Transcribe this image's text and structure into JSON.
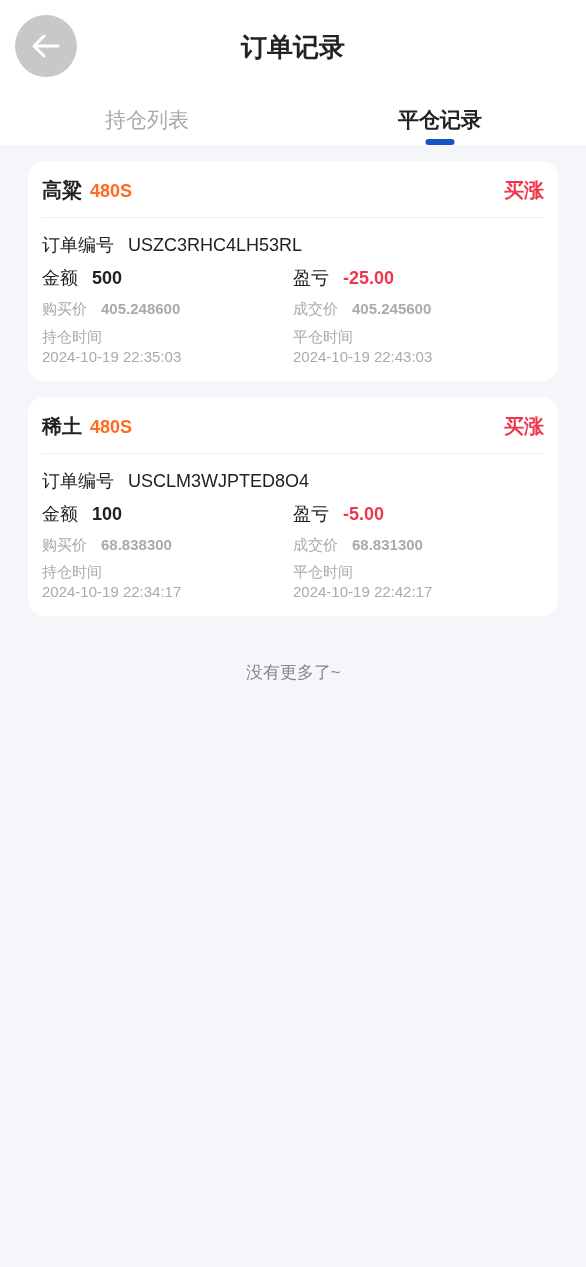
{
  "header": {
    "title": "订单记录"
  },
  "tabs": [
    {
      "label": "持仓列表",
      "selected": false
    },
    {
      "label": "平仓记录",
      "selected": true
    }
  ],
  "orders": [
    {
      "name": "高粱",
      "period": "480S",
      "direction": "买涨",
      "order_no_label": "订单编号",
      "order_no": "USZC3RHC4LH53RL",
      "amount_label": "金额",
      "amount": "500",
      "pnl_label": "盈亏",
      "pnl": "-25.00",
      "buy_price_label": "购买价",
      "buy_price": "405.248600",
      "deal_price_label": "成交价",
      "deal_price": "405.245600",
      "open_time_label": "持仓时间",
      "open_time": "2024-10-19 22:35:03",
      "close_time_label": "平仓时间",
      "close_time": "2024-10-19 22:43:03"
    },
    {
      "name": "稀土",
      "period": "480S",
      "direction": "买涨",
      "order_no_label": "订单编号",
      "order_no": "USCLM3WJPTED8O4",
      "amount_label": "金额",
      "amount": "100",
      "pnl_label": "盈亏",
      "pnl": "-5.00",
      "buy_price_label": "购买价",
      "buy_price": "68.838300",
      "deal_price_label": "成交价",
      "deal_price": "68.831300",
      "open_time_label": "持仓时间",
      "open_time": "2024-10-19 22:34:17",
      "close_time_label": "平仓时间",
      "close_time": "2024-10-19 22:42:17"
    }
  ],
  "end_note": "没有更多了~"
}
